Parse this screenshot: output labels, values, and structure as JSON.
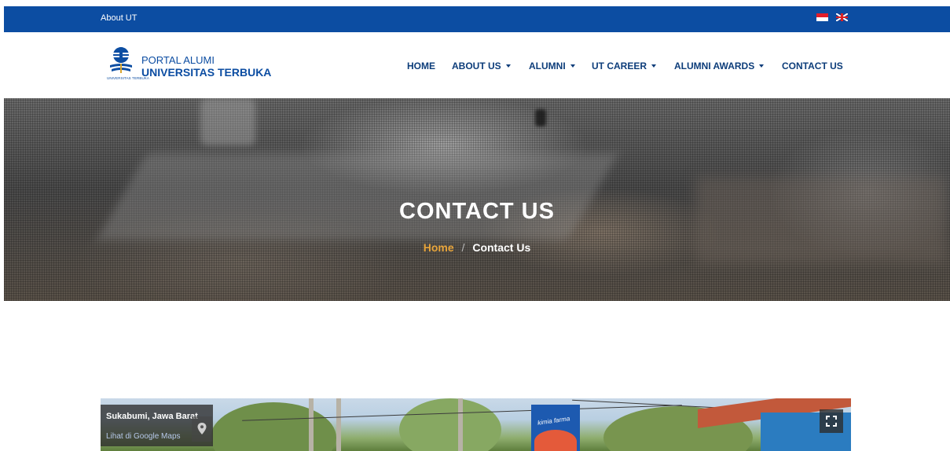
{
  "topbar": {
    "link": "About UT",
    "languages": [
      "Indonesian flag",
      "English flag"
    ]
  },
  "logo": {
    "caption": "UNIVERSITAS TERBUKA",
    "line1": "PORTAL ALUMI",
    "line2": "UNIVERSITAS TERBUKA"
  },
  "nav": {
    "items": [
      {
        "label": "HOME",
        "dropdown": false
      },
      {
        "label": "ABOUT US",
        "dropdown": true
      },
      {
        "label": "ALUMNI",
        "dropdown": true
      },
      {
        "label": "UT CAREER",
        "dropdown": true
      },
      {
        "label": "ALUMNI AWARDS",
        "dropdown": true
      },
      {
        "label": "CONTACT US",
        "dropdown": false
      }
    ]
  },
  "hero": {
    "title": "CONTACT US",
    "breadcrumb": {
      "home": "Home",
      "separator": "/",
      "current": "Contact Us"
    }
  },
  "map": {
    "place": "Sukabumi, Jawa Barat",
    "link": "Lihat di Google Maps",
    "sign_text": "kimia farma"
  },
  "colors": {
    "brand_blue": "#0c4da2",
    "nav_text": "#0d3d7a",
    "breadcrumb_accent": "#e8a53b"
  }
}
